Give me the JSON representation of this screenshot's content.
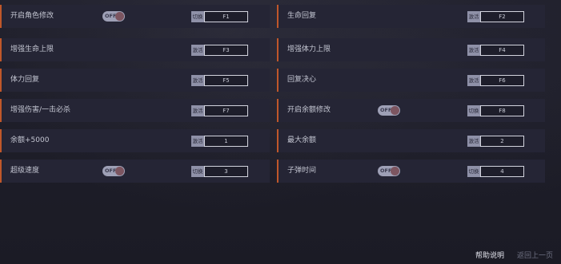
{
  "cheats": [
    {
      "label": "开启角色修改",
      "control": "toggle",
      "toggle_text": "OFF",
      "action": "切换",
      "key": "F1"
    },
    {
      "label": "生命回复",
      "control": "none",
      "action": "激活",
      "key": "F2"
    },
    {
      "label": "增强生命上限",
      "control": "none",
      "action": "激活",
      "key": "F3"
    },
    {
      "label": "增强体力上限",
      "control": "none",
      "action": "激活",
      "key": "F4"
    },
    {
      "label": "体力回复",
      "control": "none",
      "action": "激活",
      "key": "F5"
    },
    {
      "label": "回复决心",
      "control": "none",
      "action": "激活",
      "key": "F6"
    },
    {
      "label": "增强伤害/一击必杀",
      "control": "none",
      "action": "激活",
      "key": "F7"
    },
    {
      "label": "开启余额修改",
      "control": "toggle",
      "toggle_text": "OFF",
      "action": "切换",
      "key": "F8"
    },
    {
      "label": "余额+5000",
      "control": "none",
      "action": "激活",
      "key": "1"
    },
    {
      "label": "最大余额",
      "control": "none",
      "action": "激活",
      "key": "2"
    },
    {
      "label": "超级速度",
      "control": "toggle",
      "toggle_text": "OFF",
      "action": "切换",
      "key": "3"
    },
    {
      "label": "子弹时间",
      "control": "toggle",
      "toggle_text": "OFF",
      "action": "切换",
      "key": "4"
    }
  ],
  "footer": {
    "help": "帮助说明",
    "back": "返回上一页"
  },
  "colors": {
    "accent": "#c0572a",
    "row_bg": "#252535",
    "page_bg": "#1c1c27",
    "toggle_bg": "#9ea0b6"
  }
}
